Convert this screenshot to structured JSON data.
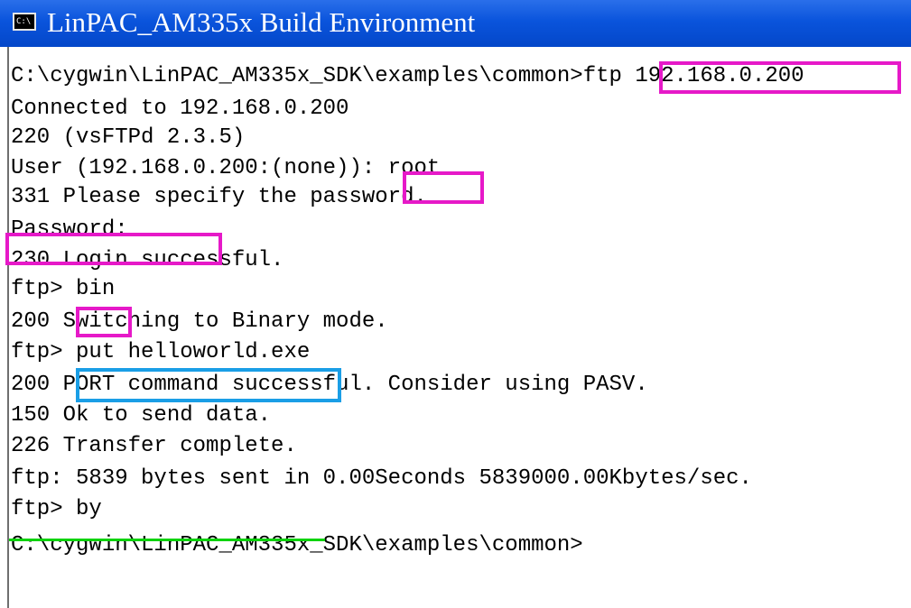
{
  "window": {
    "title": "LinPAC_AM335x Build Environment",
    "icon": "console-icon",
    "icon_text": "C:\\"
  },
  "console": {
    "lines": [
      "C:\\cygwin\\LinPAC_AM335x_SDK\\examples\\common>ftp 192.168.0.200",
      "Connected to 192.168.0.200",
      "220 (vsFTPd 2.3.5)",
      "User (192.168.0.200:(none)): root",
      "331 Please specify the password.",
      "Password:",
      "230 Login successful.",
      "ftp> bin",
      "200 Switching to Binary mode.",
      "ftp> put helloworld.exe",
      "200 PORT command successful. Consider using PASV.",
      "150 Ok to send data.",
      "226 Transfer complete.",
      "ftp: 5839 bytes sent in 0.00Seconds 5839000.00Kbytes/sec.",
      "ftp> by",
      "C:\\cygwin\\LinPAC_AM335x_SDK\\examples\\common>"
    ]
  },
  "annotations": {
    "highlight_color": "#e619c8",
    "put_highlight_color": "#1a9ee6",
    "underline_color": "#0bd30b"
  }
}
